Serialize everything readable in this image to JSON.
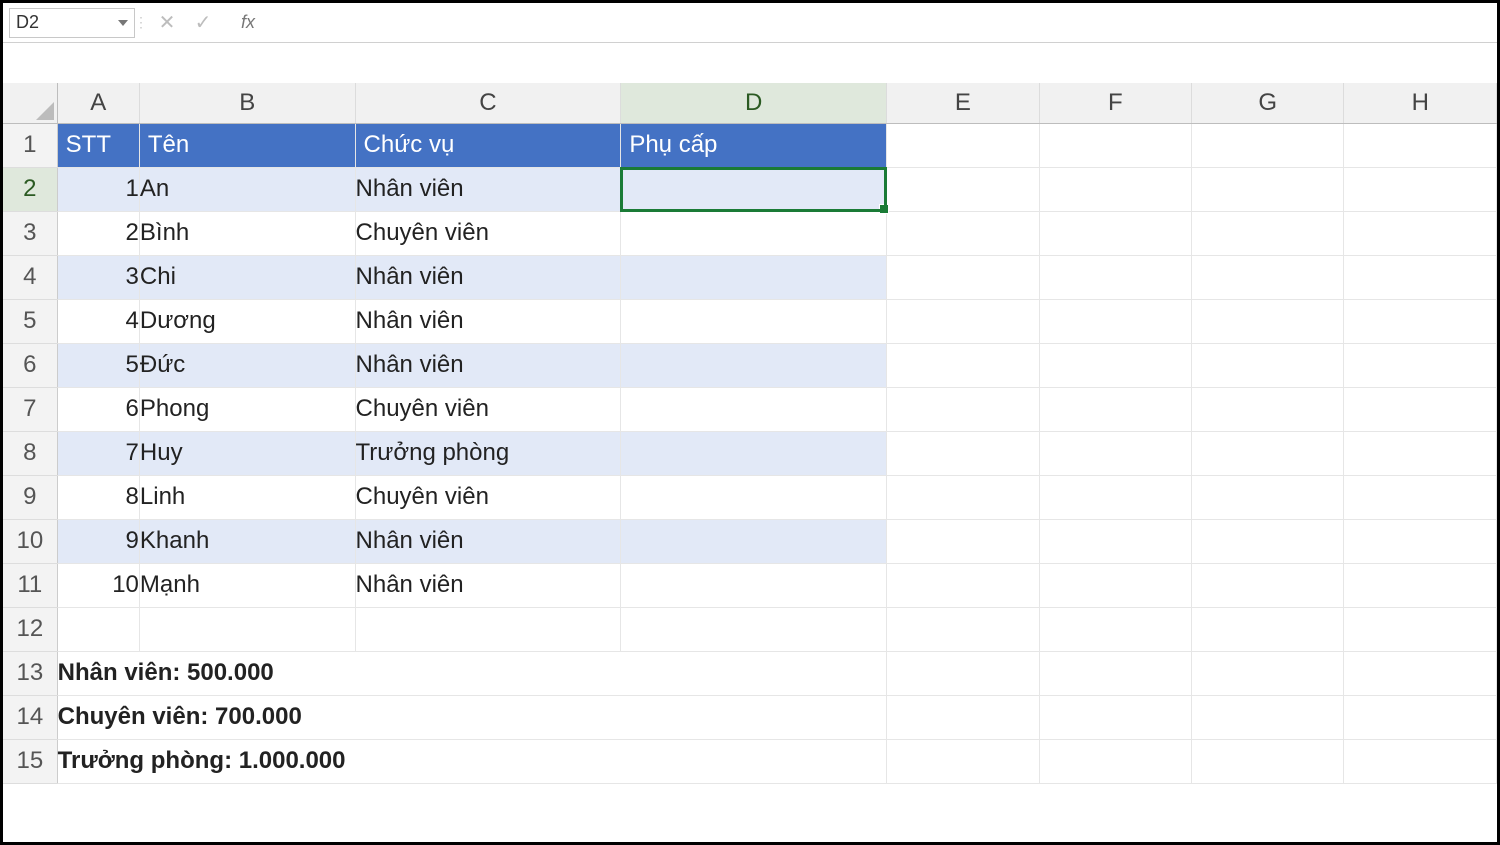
{
  "namebox": {
    "value": "D2"
  },
  "formula_bar": {
    "value": "",
    "fx_label": "fx"
  },
  "columns": [
    "A",
    "B",
    "C",
    "D",
    "E",
    "F",
    "G",
    "H"
  ],
  "active": {
    "col": "D",
    "row": 2,
    "cell": "D2"
  },
  "table": {
    "headers": {
      "stt": "STT",
      "ten": "Tên",
      "chucvu": "Chức vụ",
      "phucap": "Phụ cấp"
    },
    "rows": [
      {
        "stt": "1",
        "ten": "An",
        "chucvu": "Nhân viên",
        "phucap": ""
      },
      {
        "stt": "2",
        "ten": "Bình",
        "chucvu": "Chuyên viên",
        "phucap": ""
      },
      {
        "stt": "3",
        "ten": "Chi",
        "chucvu": "Nhân viên",
        "phucap": ""
      },
      {
        "stt": "4",
        "ten": "Dương",
        "chucvu": "Nhân viên",
        "phucap": ""
      },
      {
        "stt": "5",
        "ten": "Đức",
        "chucvu": "Nhân viên",
        "phucap": ""
      },
      {
        "stt": "6",
        "ten": "Phong",
        "chucvu": "Chuyên viên",
        "phucap": ""
      },
      {
        "stt": "7",
        "ten": "Huy",
        "chucvu": "Trưởng phòng",
        "phucap": ""
      },
      {
        "stt": "8",
        "ten": "Linh",
        "chucvu": "Chuyên viên",
        "phucap": ""
      },
      {
        "stt": "9",
        "ten": "Khanh",
        "chucvu": "Nhân viên",
        "phucap": ""
      },
      {
        "stt": "10",
        "ten": "Mạnh",
        "chucvu": "Nhân viên",
        "phucap": ""
      }
    ]
  },
  "notes": [
    {
      "label": "Nhân viên:",
      "value": "500.000"
    },
    {
      "label": "Chuyên viên:",
      "value": "700.000"
    },
    {
      "label": "Trưởng phòng:",
      "value": "1.000.000"
    }
  ],
  "visible_row_count": 15
}
